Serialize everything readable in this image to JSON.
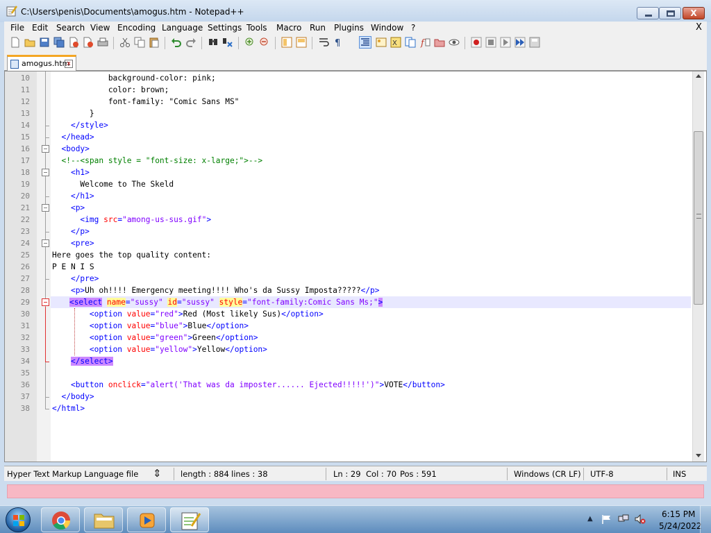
{
  "window": {
    "title": "C:\\Users\\penis\\Documents\\amogus.htm - Notepad++",
    "close_glyph": "X"
  },
  "menu": [
    "File",
    "Edit",
    "Search",
    "View",
    "Encoding",
    "Language",
    "Settings",
    "Tools",
    "Macro",
    "Run",
    "Plugins",
    "Window",
    "?"
  ],
  "menu_close": "X",
  "tab": {
    "label": "amogus.htm",
    "close_glyph": "x"
  },
  "editor": {
    "lines": [
      10,
      11,
      12,
      13,
      14,
      15,
      16,
      17,
      18,
      19,
      20,
      21,
      22,
      23,
      24,
      25,
      26,
      27,
      28,
      29,
      30,
      31,
      32,
      33,
      34,
      35,
      36,
      37,
      38
    ],
    "current_line": 29,
    "code": [
      [
        [
          "",
          "            background-color: pink;"
        ]
      ],
      [
        [
          "",
          "            color: brown;"
        ]
      ],
      [
        [
          "",
          "            font-family: \"Comic Sans MS\""
        ]
      ],
      [
        [
          "",
          "        }"
        ]
      ],
      [
        [
          "",
          "    "
        ],
        [
          "t",
          "</style>"
        ]
      ],
      [
        [
          "",
          "  "
        ],
        [
          "t",
          "</head>"
        ]
      ],
      [
        [
          "",
          "  "
        ],
        [
          "t",
          "<body>"
        ]
      ],
      [
        [
          "",
          "  "
        ],
        [
          "cm",
          "<!--<span style = \"font-size: x-large;\">-->"
        ]
      ],
      [
        [
          "",
          "    "
        ],
        [
          "t",
          "<h1>"
        ]
      ],
      [
        [
          "",
          "      Welcome to The Skeld"
        ]
      ],
      [
        [
          "",
          "    "
        ],
        [
          "t",
          "</h1>"
        ]
      ],
      [
        [
          "",
          "    "
        ],
        [
          "t",
          "<p>"
        ]
      ],
      [
        [
          "",
          "      "
        ],
        [
          "t",
          "<img "
        ],
        [
          "a",
          "src"
        ],
        [
          "t",
          "="
        ],
        [
          "v",
          "\"among-us-sus.gif\""
        ],
        [
          "t",
          ">"
        ]
      ],
      [
        [
          "",
          "    "
        ],
        [
          "t",
          "</p>"
        ]
      ],
      [
        [
          "",
          "    "
        ],
        [
          "t",
          "<pre>"
        ]
      ],
      [
        [
          "",
          "Here goes the top quality content:"
        ]
      ],
      [
        [
          "",
          "P E N I S"
        ]
      ],
      [
        [
          "",
          "    "
        ],
        [
          "t",
          "</pre>"
        ]
      ],
      [
        [
          "",
          "    "
        ],
        [
          "t",
          "<p>"
        ],
        [
          "",
          "Uh oh!!!! Emergency meeting!!!! Who's da Sussy Imposta?????"
        ],
        [
          "t",
          "</p>"
        ]
      ],
      [
        [
          "",
          "    "
        ],
        [
          "t hl",
          "<select"
        ],
        [
          "t",
          " "
        ],
        [
          "a ah",
          "name"
        ],
        [
          "t",
          "="
        ],
        [
          "v",
          "\"sussy\""
        ],
        [
          "t",
          " "
        ],
        [
          "a ah",
          "id"
        ],
        [
          "t",
          "="
        ],
        [
          "v",
          "\"sussy\""
        ],
        [
          "t",
          " "
        ],
        [
          "a ah",
          "style"
        ],
        [
          "t",
          "="
        ],
        [
          "v",
          "\"font-family:Comic Sans Ms;\""
        ],
        [
          "t hl",
          ">"
        ]
      ],
      [
        [
          "",
          "        "
        ],
        [
          "t",
          "<option "
        ],
        [
          "a",
          "value"
        ],
        [
          "t",
          "="
        ],
        [
          "v",
          "\"red\""
        ],
        [
          "t",
          ">"
        ],
        [
          "",
          "Red (Most likely Sus)"
        ],
        [
          "t",
          "</option>"
        ]
      ],
      [
        [
          "",
          "        "
        ],
        [
          "t",
          "<option "
        ],
        [
          "a",
          "value"
        ],
        [
          "t",
          "="
        ],
        [
          "v",
          "\"blue\""
        ],
        [
          "t",
          ">"
        ],
        [
          "",
          "Blue"
        ],
        [
          "t",
          "</option>"
        ]
      ],
      [
        [
          "",
          "        "
        ],
        [
          "t",
          "<option "
        ],
        [
          "a",
          "value"
        ],
        [
          "t",
          "="
        ],
        [
          "v",
          "\"green\""
        ],
        [
          "t",
          ">"
        ],
        [
          "",
          "Green"
        ],
        [
          "t",
          "</option>"
        ]
      ],
      [
        [
          "",
          "        "
        ],
        [
          "t",
          "<option "
        ],
        [
          "a",
          "value"
        ],
        [
          "t",
          "="
        ],
        [
          "v",
          "\"yellow\""
        ],
        [
          "t",
          ">"
        ],
        [
          "",
          "Yellow"
        ],
        [
          "t",
          "</option>"
        ]
      ],
      [
        [
          "",
          "    "
        ],
        [
          "t hl",
          "</select>"
        ]
      ],
      [
        [
          "",
          ""
        ]
      ],
      [
        [
          "",
          "    "
        ],
        [
          "t",
          "<button "
        ],
        [
          "a",
          "onclick"
        ],
        [
          "t",
          "="
        ],
        [
          "v",
          "\"alert('That was da imposter...... Ejected!!!!!')\""
        ],
        [
          "t",
          ">"
        ],
        [
          "",
          "VOTE"
        ],
        [
          "t",
          "</button>"
        ]
      ],
      [
        [
          "",
          "  "
        ],
        [
          "t",
          "</body>"
        ]
      ],
      [
        [
          "",
          ""
        ],
        [
          "t",
          "</html>"
        ]
      ]
    ]
  },
  "status": {
    "file_type": "Hyper Text Markup Language file",
    "length": "length : 884",
    "lines": "lines : 38",
    "ln": "Ln : 29",
    "col": "Col : 70",
    "pos": "Pos : 591",
    "eol": "Windows (CR LF)",
    "encoding": "UTF-8",
    "mode": "INS"
  },
  "taskbar": {
    "time": "6:15 PM",
    "date": "5/24/2022"
  }
}
